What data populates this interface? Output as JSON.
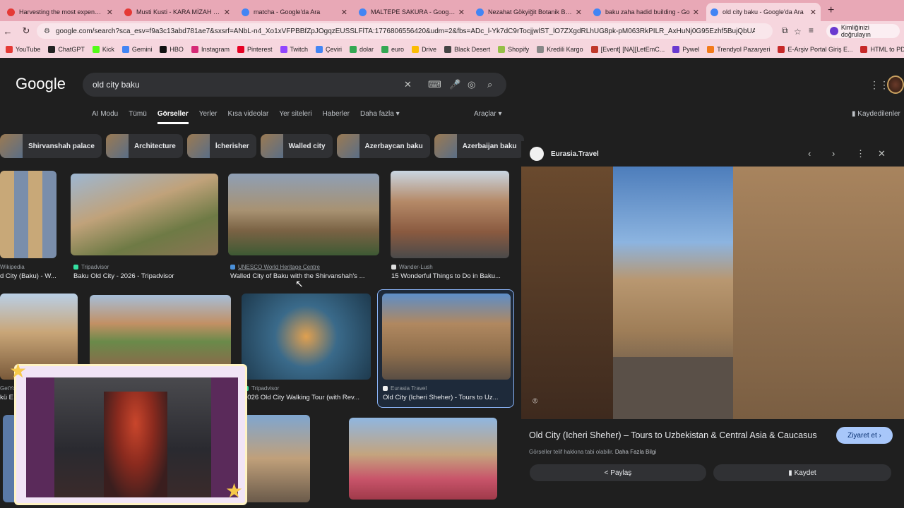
{
  "browser": {
    "tabs": [
      {
        "title": "Harvesting the most expensive",
        "color": "#e53935",
        "active": false
      },
      {
        "title": "Musti Kusti - KARA MİZAH | Si",
        "color": "#e53935",
        "active": false
      },
      {
        "title": "matcha - Google'da Ara",
        "color": "#4285f4",
        "active": false
      },
      {
        "title": "MALTEPE SAKURA - Google'da",
        "color": "#4285f4",
        "active": false
      },
      {
        "title": "Nezahat Gökyiğit Botanik Bahç",
        "color": "#4285f4",
        "active": false
      },
      {
        "title": "baku zaha hadid building - Go",
        "color": "#4285f4",
        "active": false
      },
      {
        "title": "old city baku - Google'da Ara",
        "color": "#4285f4",
        "active": true
      }
    ],
    "url": "google.com/search?sca_esv=f9a3c13abd781ae7&sxsrf=ANbL-n4_Xo1xVFPBBfZpJOgqzEUSSLFlTA:1776806556420&udm=2&fbs=ADc_l-Yk7dC9rTocjjwlST_lO7ZXgdRLhUG8pk-pM063RkPILR_AxHuNj0G95Ezhf5BujQbUAbcMco90...",
    "profile_label": "Kimliğinizi doğrulayın",
    "bookmarks": [
      {
        "label": "YouTube",
        "color": "#e53935"
      },
      {
        "label": "ChatGPT",
        "color": "#222"
      },
      {
        "label": "Kick",
        "color": "#53fc18"
      },
      {
        "label": "Gemini",
        "color": "#4285f4"
      },
      {
        "label": "HBO",
        "color": "#111"
      },
      {
        "label": "Instagram",
        "color": "#d62976"
      },
      {
        "label": "Pinterest",
        "color": "#e60023"
      },
      {
        "label": "Twitch",
        "color": "#9146ff"
      },
      {
        "label": "Çeviri",
        "color": "#4285f4"
      },
      {
        "label": "dolar",
        "color": "#34a853"
      },
      {
        "label": "euro",
        "color": "#34a853"
      },
      {
        "label": "Drive",
        "color": "#fbbc04"
      },
      {
        "label": "Black Desert",
        "color": "#444"
      },
      {
        "label": "Shopify",
        "color": "#95bf47"
      },
      {
        "label": "Kredili Kargo",
        "color": "#888"
      },
      {
        "label": "[Event] [NA][LetEmC...",
        "color": "#c0392b"
      },
      {
        "label": "Pywel",
        "color": "#6a3ad0"
      },
      {
        "label": "Trendyol Pazaryeri",
        "color": "#f27a1a"
      },
      {
        "label": "E-Arşiv Portal Giriş E...",
        "color": "#c62828"
      },
      {
        "label": "HTML to PDF",
        "color": "#c62828"
      }
    ]
  },
  "google": {
    "logo": "Google",
    "query": "old city baku",
    "nav_tabs": [
      "AI Modu",
      "Tümü",
      "Görseller",
      "Yerler",
      "Kısa videolar",
      "Yer siteleri",
      "Haberler",
      "Daha fazla ▾"
    ],
    "selected_tab": "Görseller",
    "tools": "Araçlar ▾",
    "saved": "Kaydedilenler",
    "chips": [
      "Shirvanshah palace",
      "Architecture",
      "İcherisher",
      "Walled city",
      "Azerbaycan baku",
      "Azerbaijan baku"
    ]
  },
  "results": [
    {
      "source": "Wikipedia",
      "title": "d City (Baku) - W..."
    },
    {
      "source": "Tripadvisor",
      "title": "Baku Old City - 2026 - Tripadvisor"
    },
    {
      "source": "UNESCO World Heritage Centre",
      "title": "Walled City of Baku with the Shirvanshah's ..."
    },
    {
      "source": "Wander-Lush",
      "title": "15 Wonderful Things to Do in Baku..."
    },
    {
      "source": "GetYou",
      "title": "kü Es..."
    },
    {
      "source": "Tripadvisor",
      "title": "2026 Old City Walking Tour (with Rev..."
    },
    {
      "source": "Eurasia Travel",
      "title": "Old City (Icheri Sheher) - Tours to Uz..."
    }
  ],
  "preview": {
    "site": "Eurasia.Travel",
    "title": "Old City (Icheri Sheher) – Tours to Uzbekistan & Central Asia & Caucasus",
    "visit_label": "Ziyaret et ›",
    "copyright": "Görseller telif hakkına tabi olabilir.",
    "more_info": "Daha Fazla Bilgi",
    "share_label": "Paylaş",
    "save_label": "Kaydet"
  }
}
